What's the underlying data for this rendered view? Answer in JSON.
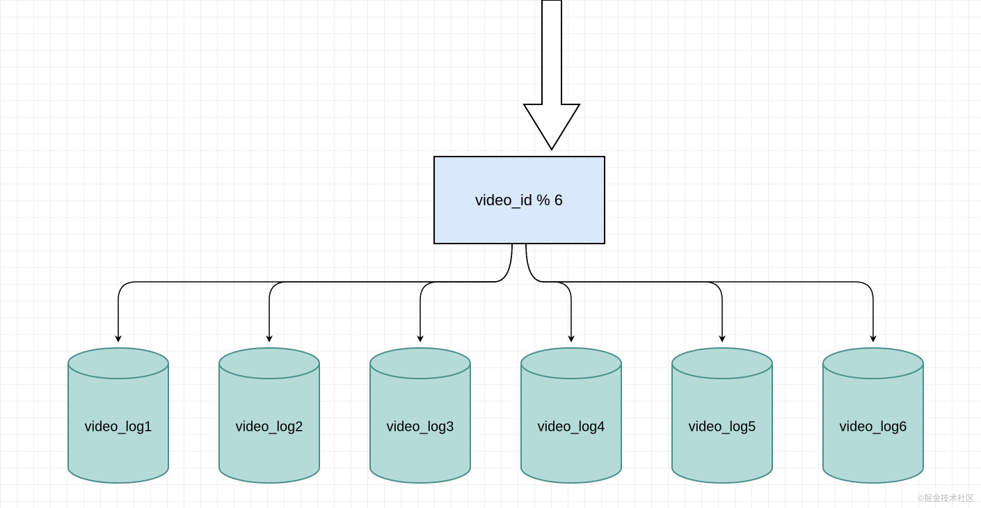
{
  "diagram": {
    "router_label": "video_id % 6",
    "cylinders": [
      {
        "label": "video_log1"
      },
      {
        "label": "video_log2"
      },
      {
        "label": "video_log3"
      },
      {
        "label": "video_log4"
      },
      {
        "label": "video_log5"
      },
      {
        "label": "video_log6"
      }
    ],
    "colors": {
      "grid": "#f0f0f0",
      "stroke": "#000000",
      "router_fill": "#d9e8fb",
      "cylinder_fill": "#b5dbd8",
      "cylinder_stroke": "#4a8f8a"
    }
  },
  "watermark": "©掘金技术社区"
}
